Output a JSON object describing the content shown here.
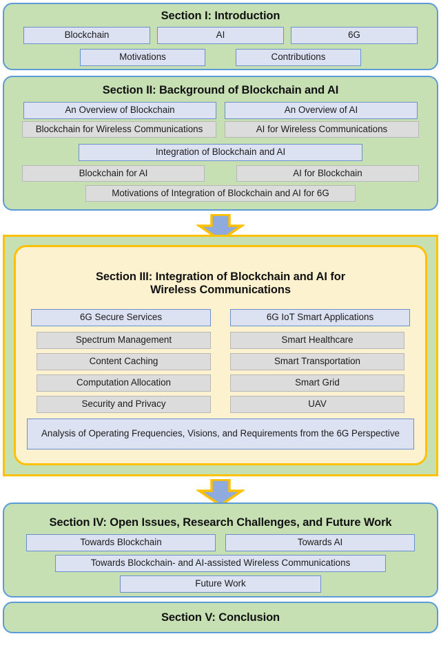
{
  "diagram": {
    "title": "Survey paper organization flowchart",
    "colors": {
      "section_fill": "#c6e0b4",
      "section_border": "#5b9bd5",
      "blue_node_fill": "#dde2f2",
      "blue_node_border": "#6b8fc9",
      "grey_node_fill": "#dcdcdc",
      "grey_node_border": "#b7b7b7",
      "highlight_border": "#ffc000",
      "highlight_fill": "#fdf2d0",
      "arrow_fill": "#8faadc",
      "arrow_border": "#ffc000"
    }
  },
  "section1": {
    "title": "Section I: Introduction",
    "row1": [
      {
        "label": "Blockchain",
        "style": "blue"
      },
      {
        "label": "AI",
        "style": "blue"
      },
      {
        "label": "6G",
        "style": "blue"
      }
    ],
    "row2": [
      {
        "label": "Motivations",
        "style": "blue"
      },
      {
        "label": "Contributions",
        "style": "blue"
      }
    ]
  },
  "section2": {
    "title": "Section II: Background of Blockchain and AI",
    "row1": [
      {
        "label": "An Overview of Blockchain",
        "style": "blue"
      },
      {
        "label": "An Overview of AI",
        "style": "blue"
      }
    ],
    "row2": [
      {
        "label": "Blockchain for Wireless Communications",
        "style": "grey"
      },
      {
        "label": "AI for Wireless Communications",
        "style": "grey"
      }
    ],
    "row3": [
      {
        "label": "Integration of Blockchain and AI",
        "style": "blue"
      }
    ],
    "row4": [
      {
        "label": "Blockchain for AI",
        "style": "grey"
      },
      {
        "label": "AI for Blockchain",
        "style": "grey"
      }
    ],
    "row5": [
      {
        "label": "Motivations of Integration of Blockchain and AI for 6G",
        "style": "grey"
      }
    ]
  },
  "section3": {
    "title": "Section III: Integration of Blockchain and AI for Wireless Communications",
    "title_line1": "Section III: Integration of Blockchain and AI for",
    "title_line2": "Wireless Communications",
    "column_headers": [
      {
        "label": "6G Secure Services",
        "style": "blue"
      },
      {
        "label": "6G IoT Smart Applications",
        "style": "blue"
      }
    ],
    "left_column": [
      {
        "label": "Spectrum Management",
        "style": "grey"
      },
      {
        "label": "Content Caching",
        "style": "grey"
      },
      {
        "label": "Computation Allocation",
        "style": "grey"
      },
      {
        "label": "Security and Privacy",
        "style": "grey"
      }
    ],
    "right_column": [
      {
        "label": "Smart Healthcare",
        "style": "grey"
      },
      {
        "label": "Smart Transportation",
        "style": "grey"
      },
      {
        "label": "Smart Grid",
        "style": "grey"
      },
      {
        "label": "UAV",
        "style": "grey"
      }
    ],
    "footer": {
      "label": "Analysis of Operating Frequencies, Visions, and Requirements from the 6G Perspective",
      "style": "blue"
    }
  },
  "section4": {
    "title": "Section IV: Open Issues, Research Challenges, and Future Work",
    "row1": [
      {
        "label": "Towards Blockchain",
        "style": "blue"
      },
      {
        "label": "Towards AI",
        "style": "blue"
      }
    ],
    "row2": [
      {
        "label": "Towards Blockchain- and AI-assisted Wireless Communications",
        "style": "blue"
      }
    ],
    "row3": [
      {
        "label": "Future Work",
        "style": "blue"
      }
    ]
  },
  "section5": {
    "title": "Section V: Conclusion"
  },
  "arrows": [
    {
      "name": "arrow-section2-to-section3",
      "direction": "down"
    },
    {
      "name": "arrow-section3-to-section4",
      "direction": "down"
    }
  ]
}
